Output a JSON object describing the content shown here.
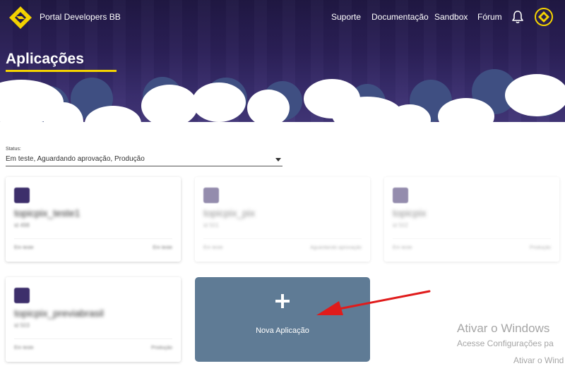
{
  "header": {
    "brand": "Portal Developers BB",
    "nav": [
      "Suporte",
      "Documentação",
      "Sandbox",
      "Fórum"
    ],
    "page_title": "Aplicações"
  },
  "filter": {
    "label": "Status:",
    "value": "Em teste, Aguardando aprovação, Produção"
  },
  "apps": [
    {
      "name": "topicpix_teste1",
      "sub": "id 498",
      "left": "Em teste",
      "right": "Em teste"
    },
    {
      "name": "topicpix_pix",
      "sub": "id 501",
      "left": "Em teste",
      "right": "Aguardando aprovação"
    },
    {
      "name": "topicpix",
      "sub": "id 502",
      "left": "Em teste",
      "right": "Produção"
    },
    {
      "name": "topicpix_previabrasil",
      "sub": "id 503",
      "left": "Em teste",
      "right": "Produção"
    }
  ],
  "new_app": {
    "label": "Nova Aplicação"
  },
  "watermark": {
    "title": "Ativar o Windows",
    "line1": "Acesse Configurações pa",
    "line2": "Ativar o Wind"
  },
  "colors": {
    "header": "#2b2058",
    "accent": "#f5d300",
    "new_app_bg": "#5f7b95",
    "arrow": "#e01b1b"
  }
}
